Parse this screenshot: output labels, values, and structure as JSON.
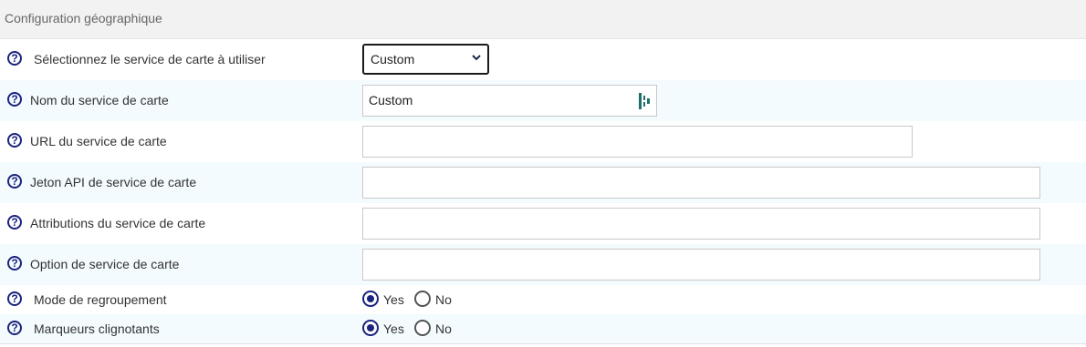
{
  "section_title": "Configuration géographique",
  "rows": [
    {
      "label": "Sélectionnez le service de carte à utiliser",
      "select_value": "Custom"
    },
    {
      "label": "Nom du service de carte",
      "value": "Custom"
    },
    {
      "label": "URL du service de carte",
      "value": ""
    },
    {
      "label": "Jeton API de service de carte",
      "value": ""
    },
    {
      "label": "Attributions du service de carte",
      "value": ""
    },
    {
      "label": "Option de service de carte",
      "value": ""
    },
    {
      "label": "Mode de regroupement",
      "options": [
        "Yes",
        "No"
      ],
      "selected": "Yes"
    },
    {
      "label": "Marqueurs clignotants",
      "options": [
        "Yes",
        "No"
      ],
      "selected": "Yes"
    }
  ],
  "colors": {
    "accent": "#1a237e",
    "alt_row": "#f4fbfe",
    "header_bg": "#f2f2f2"
  },
  "icons": {
    "help": "question-circle-icon",
    "dropdown": "chevron-down-icon",
    "field_addon": "password-manager-icon"
  },
  "help_glyph": "?"
}
